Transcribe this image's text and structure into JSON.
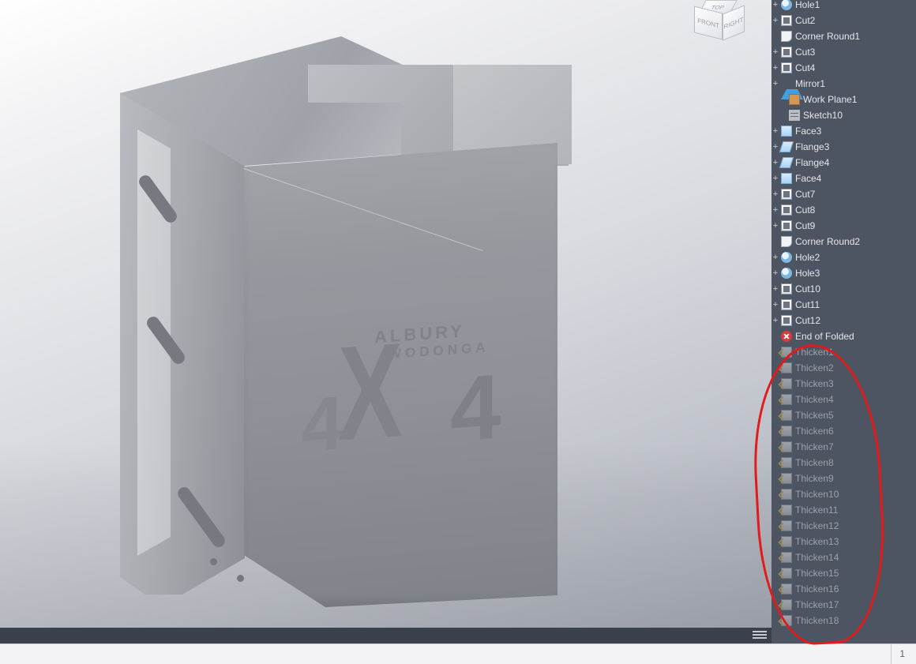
{
  "viewcube": {
    "top": "TOP",
    "front": "FRONT",
    "right": "RIGHT"
  },
  "part_text": {
    "line1": "ALBURY",
    "line2": "WODONGA",
    "glyph_left": "4",
    "glyph_center": "X",
    "glyph_right": "4"
  },
  "status": {
    "value": "1"
  },
  "browser": {
    "items": [
      {
        "label": "Hole1",
        "icon": "hole",
        "indent": 14,
        "expand": "+",
        "dim": false
      },
      {
        "label": "Cut2",
        "icon": "cut",
        "indent": 14,
        "expand": "+",
        "dim": false
      },
      {
        "label": "Corner Round1",
        "icon": "round",
        "indent": 14,
        "expand": "",
        "dim": false
      },
      {
        "label": "Cut3",
        "icon": "cut",
        "indent": 14,
        "expand": "+",
        "dim": false
      },
      {
        "label": "Cut4",
        "icon": "cut",
        "indent": 14,
        "expand": "+",
        "dim": false
      },
      {
        "label": "Mirror1",
        "icon": "mirror",
        "indent": 14,
        "expand": "+",
        "dim": false
      },
      {
        "label": "Work Plane1",
        "icon": "plane",
        "indent": 24,
        "expand": "",
        "dim": false
      },
      {
        "label": "Sketch10",
        "icon": "sketch",
        "indent": 24,
        "expand": "",
        "dim": false
      },
      {
        "label": "Face3",
        "icon": "face",
        "indent": 14,
        "expand": "+",
        "dim": false
      },
      {
        "label": "Flange3",
        "icon": "flange",
        "indent": 14,
        "expand": "+",
        "dim": false
      },
      {
        "label": "Flange4",
        "icon": "flange",
        "indent": 14,
        "expand": "+",
        "dim": false
      },
      {
        "label": "Face4",
        "icon": "face",
        "indent": 14,
        "expand": "+",
        "dim": false
      },
      {
        "label": "Cut7",
        "icon": "cut",
        "indent": 14,
        "expand": "+",
        "dim": false
      },
      {
        "label": "Cut8",
        "icon": "cut",
        "indent": 14,
        "expand": "+",
        "dim": false
      },
      {
        "label": "Cut9",
        "icon": "cut",
        "indent": 14,
        "expand": "+",
        "dim": false
      },
      {
        "label": "Corner Round2",
        "icon": "round",
        "indent": 14,
        "expand": "",
        "dim": false
      },
      {
        "label": "Hole2",
        "icon": "hole",
        "indent": 14,
        "expand": "+",
        "dim": false
      },
      {
        "label": "Hole3",
        "icon": "hole",
        "indent": 14,
        "expand": "+",
        "dim": false
      },
      {
        "label": "Cut10",
        "icon": "cut",
        "indent": 14,
        "expand": "+",
        "dim": false
      },
      {
        "label": "Cut11",
        "icon": "cut",
        "indent": 14,
        "expand": "+",
        "dim": false
      },
      {
        "label": "Cut12",
        "icon": "cut",
        "indent": 14,
        "expand": "+",
        "dim": false
      },
      {
        "label": "End of Folded",
        "icon": "end",
        "indent": 14,
        "expand": "",
        "dim": false
      },
      {
        "label": "Thicken1",
        "icon": "thick",
        "indent": 14,
        "expand": "",
        "dim": true
      },
      {
        "label": "Thicken2",
        "icon": "thick",
        "indent": 14,
        "expand": "",
        "dim": true
      },
      {
        "label": "Thicken3",
        "icon": "thick",
        "indent": 14,
        "expand": "",
        "dim": true
      },
      {
        "label": "Thicken4",
        "icon": "thick",
        "indent": 14,
        "expand": "",
        "dim": true
      },
      {
        "label": "Thicken5",
        "icon": "thick",
        "indent": 14,
        "expand": "",
        "dim": true
      },
      {
        "label": "Thicken6",
        "icon": "thick",
        "indent": 14,
        "expand": "",
        "dim": true
      },
      {
        "label": "Thicken7",
        "icon": "thick",
        "indent": 14,
        "expand": "",
        "dim": true
      },
      {
        "label": "Thicken8",
        "icon": "thick",
        "indent": 14,
        "expand": "",
        "dim": true
      },
      {
        "label": "Thicken9",
        "icon": "thick",
        "indent": 14,
        "expand": "",
        "dim": true
      },
      {
        "label": "Thicken10",
        "icon": "thick",
        "indent": 14,
        "expand": "",
        "dim": true
      },
      {
        "label": "Thicken11",
        "icon": "thick",
        "indent": 14,
        "expand": "",
        "dim": true
      },
      {
        "label": "Thicken12",
        "icon": "thick",
        "indent": 14,
        "expand": "",
        "dim": true
      },
      {
        "label": "Thicken13",
        "icon": "thick",
        "indent": 14,
        "expand": "",
        "dim": true
      },
      {
        "label": "Thicken14",
        "icon": "thick",
        "indent": 14,
        "expand": "",
        "dim": true
      },
      {
        "label": "Thicken15",
        "icon": "thick",
        "indent": 14,
        "expand": "",
        "dim": true
      },
      {
        "label": "Thicken16",
        "icon": "thick",
        "indent": 14,
        "expand": "",
        "dim": true
      },
      {
        "label": "Thicken17",
        "icon": "thick",
        "indent": 14,
        "expand": "",
        "dim": true
      },
      {
        "label": "Thicken18",
        "icon": "thick",
        "indent": 14,
        "expand": "",
        "dim": true
      }
    ]
  }
}
